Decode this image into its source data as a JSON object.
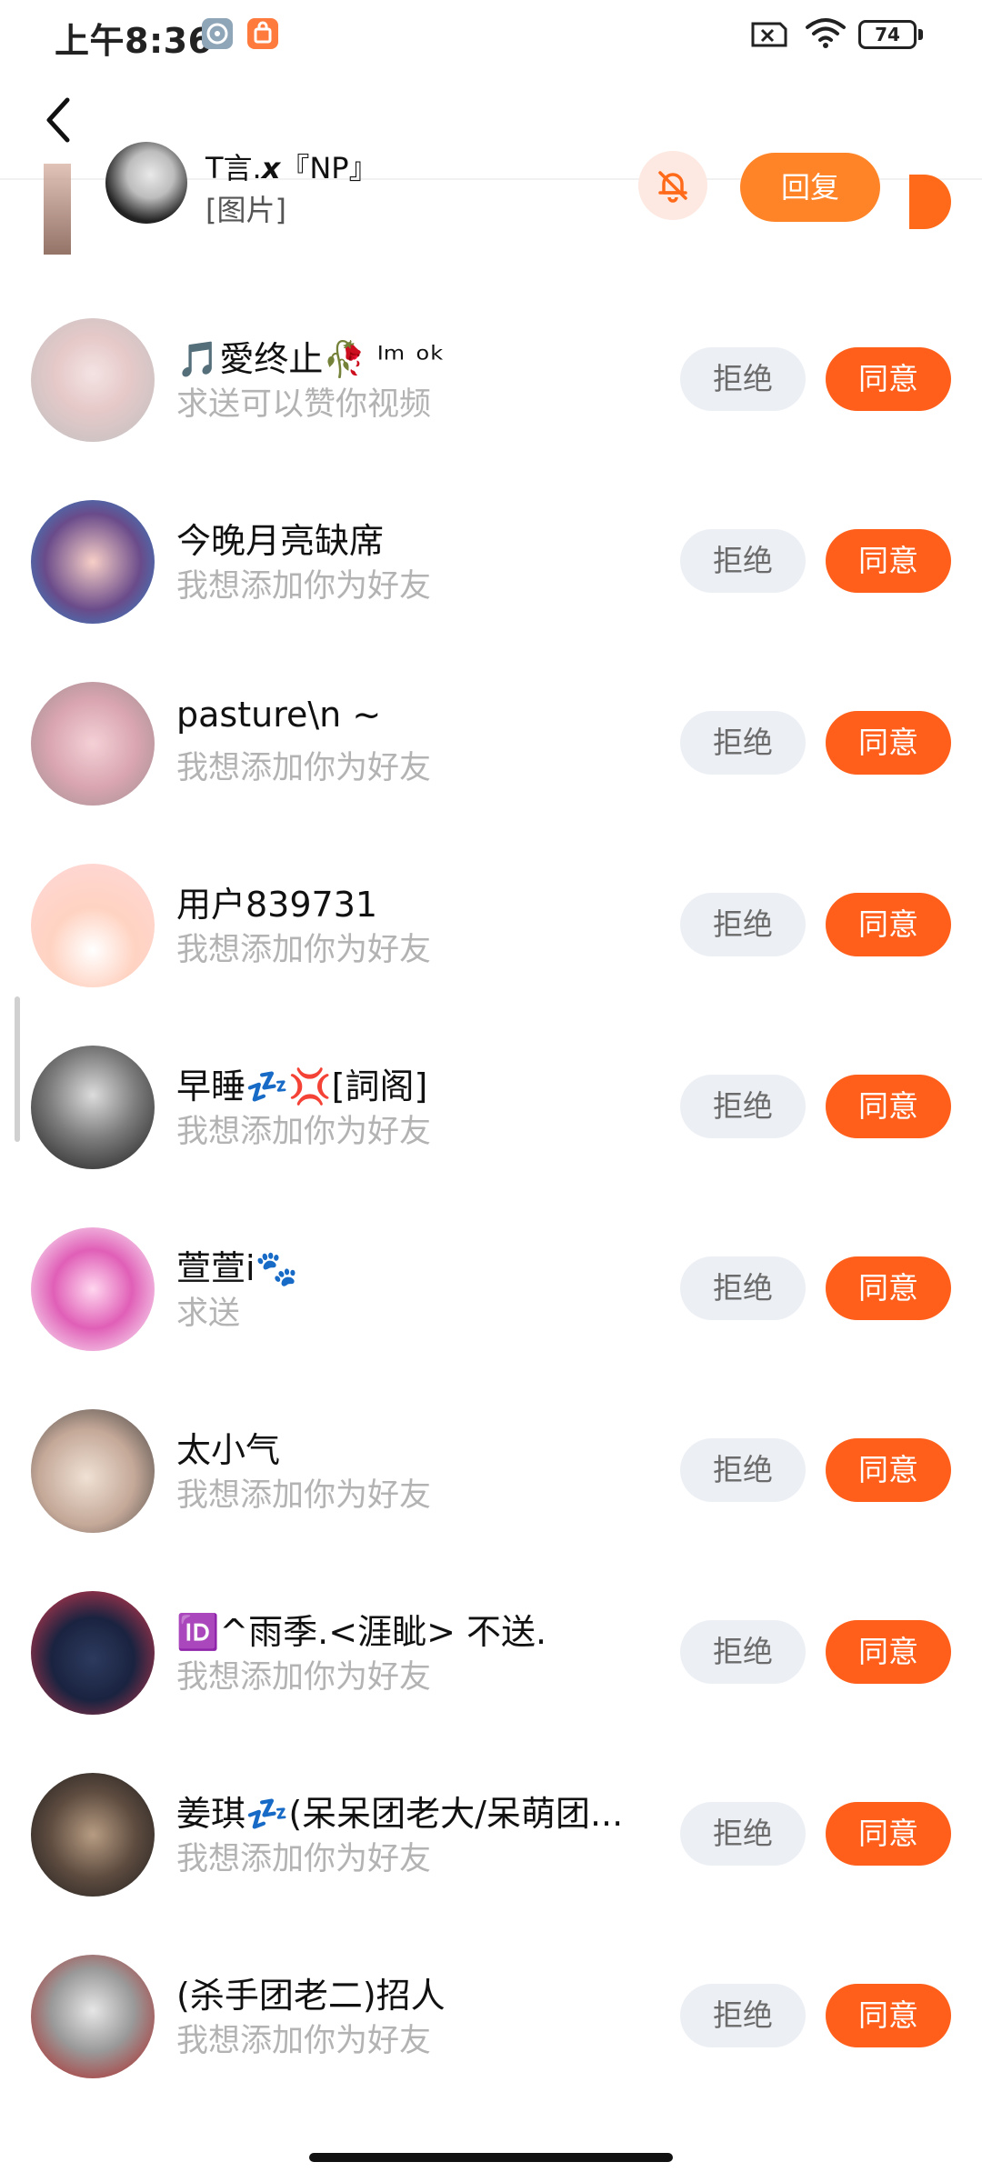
{
  "status_bar": {
    "time": "上午8:36",
    "battery": "74",
    "icons": [
      "app-gray-icon",
      "app-orange-icon",
      "sim-off-icon",
      "wifi-icon",
      "battery-icon"
    ]
  },
  "notification": {
    "name": "T言.𝙭『NP』",
    "message": "[图片]",
    "reply_label": "回复",
    "mute_icon": "bell-off-icon"
  },
  "requests": [
    {
      "name": "🎵愛终止🥀 ᴵᵐ ᵒᵏ",
      "message": "求送可以赞你视频",
      "reject": "拒绝",
      "accept": "同意"
    },
    {
      "name": "今晚月亮缺席",
      "message": "我想添加你为好友",
      "reject": "拒绝",
      "accept": "同意"
    },
    {
      "name": "pasture\\n ~",
      "message": "我想添加你为好友",
      "reject": "拒绝",
      "accept": "同意"
    },
    {
      "name": "用户839731",
      "message": "我想添加你为好友",
      "reject": "拒绝",
      "accept": "同意"
    },
    {
      "name": "早睡💤💢[詞阁]",
      "message": "我想添加你为好友",
      "reject": "拒绝",
      "accept": "同意"
    },
    {
      "name": "萱萱i🐾",
      "message": "求送",
      "reject": "拒绝",
      "accept": "同意"
    },
    {
      "name": "太小气",
      "message": "我想添加你为好友",
      "reject": "拒绝",
      "accept": "同意"
    },
    {
      "name": "🆔^雨季.<涯眦> 不送.",
      "message": "我想添加你为好友",
      "reject": "拒绝",
      "accept": "同意"
    },
    {
      "name": "姜琪💤(呆呆团老大/呆萌团...",
      "message": "我想添加你为好友",
      "reject": "拒绝",
      "accept": "同意"
    },
    {
      "name": "(杀手团老二)招人",
      "message": "我想添加你为好友",
      "reject": "拒绝",
      "accept": "同意"
    }
  ]
}
